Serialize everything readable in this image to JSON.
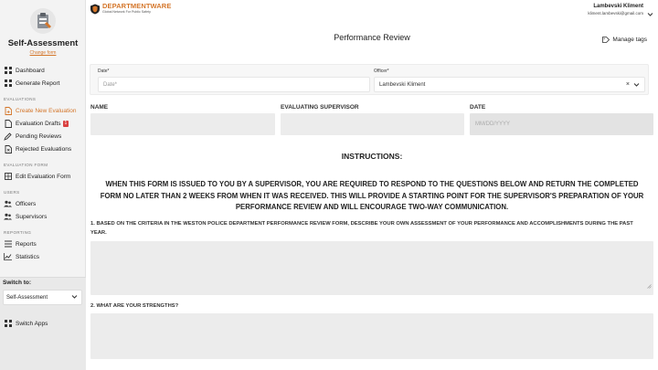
{
  "app": {
    "title": "Self-Assessment",
    "change_form": "Change form"
  },
  "sidebar": {
    "top_items": [
      {
        "label": "Dashboard",
        "icon": "grid-icon"
      },
      {
        "label": "Generate Report",
        "icon": "grid-icon"
      }
    ],
    "sections": {
      "evaluations": "EVALUATIONS",
      "evaluation_form": "EVALUATION FORM",
      "users": "USERS",
      "reporting": "REPORTING"
    },
    "evaluation_items": [
      {
        "label": "Create New Evaluation",
        "icon": "file-plus-icon",
        "active": true
      },
      {
        "label": "Evaluation Drafts",
        "icon": "file-icon",
        "badge": "1"
      },
      {
        "label": "Pending Reviews",
        "icon": "pencil-icon"
      },
      {
        "label": "Rejected Evaluations",
        "icon": "file-x-icon"
      }
    ],
    "form_items": [
      {
        "label": "Edit Evaluation Form",
        "icon": "edit-grid-icon"
      }
    ],
    "user_items": [
      {
        "label": "Officers",
        "icon": "users-icon"
      },
      {
        "label": "Supervisors",
        "icon": "users-icon"
      }
    ],
    "reporting_items": [
      {
        "label": "Reports",
        "icon": "list-icon"
      },
      {
        "label": "Statistics",
        "icon": "chart-icon"
      }
    ],
    "switch_to_label": "Switch to:",
    "switch_to_value": "Self-Assessment",
    "switch_apps": "Switch Apps"
  },
  "header": {
    "brand_name": "DEPARTMENTWARE",
    "brand_tagline": "Global Network For Public Safety",
    "user_name": "Lambevski Kliment",
    "user_email": "kliment.lambevski@gmail.com"
  },
  "page": {
    "title": "Performance Review",
    "manage_tags": "Manage tags"
  },
  "form": {
    "date_label": "Date*",
    "date_placeholder": "Date*",
    "officer_label": "Officer*",
    "officer_value": "Lambevski Kliment",
    "name_label": "NAME",
    "supervisor_label": "EVALUATING SUPERVISOR",
    "date_col_label": "DATE",
    "date_col_placeholder": "MM/DD/YYYY"
  },
  "instructions": {
    "title": "INSTRUCTIONS:",
    "text": "WHEN THIS FORM IS ISSUED TO YOU BY A SUPERVISOR, YOU ARE REQUIRED TO RESPOND TO THE QUESTIONS BELOW AND RETURN THE COMPLETED FORM NO LATER THAN 2 WEEKS FROM WHEN IT WAS RECEIVED. THIS WILL PROVIDE A STARTING POINT FOR THE SUPERVISOR'S PREPARATION OF YOUR PERFORMANCE REVIEW AND WILL ENCOURAGE TWO-WAY COMMUNICATION."
  },
  "questions": [
    "1. BASED ON THE CRITERIA IN THE WESTON POLICE DEPARTMENT PERFORMANCE REVIEW FORM, DESCRIBE YOUR OWN ASSESSMENT OF YOUR PERFORMANCE AND ACCOMPLISHMENTS DURING THE PAST YEAR.",
    "2. WHAT ARE YOUR STRENGTHS?"
  ],
  "colors": {
    "accent": "#d4762a",
    "badge": "#d94040",
    "sidebar_bg": "#f3f3f3",
    "field_bg": "#ececec"
  }
}
